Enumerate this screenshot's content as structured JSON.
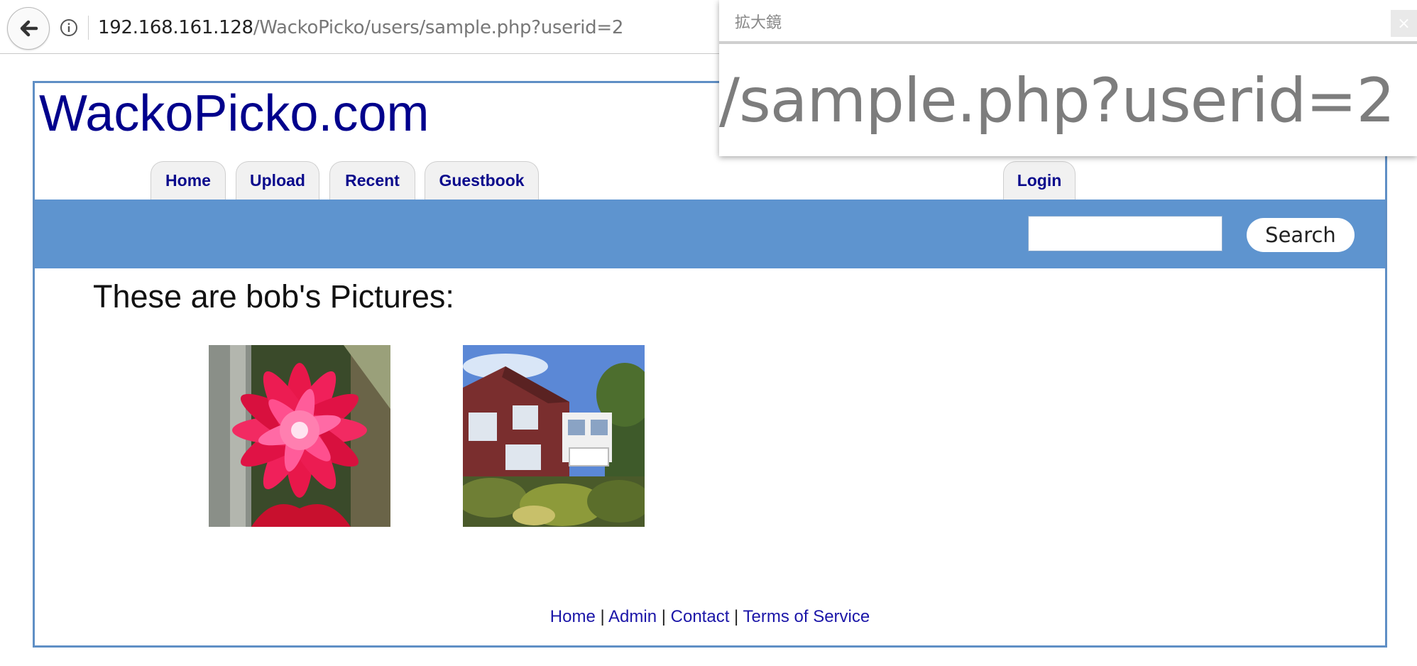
{
  "browser": {
    "url_host": "192.168.161.128",
    "url_path": "/WackoPicko/users/sample.php?userid=2",
    "back_icon": "back-arrow-icon",
    "info_icon": "info-icon"
  },
  "site": {
    "title": "WackoPicko.com",
    "nav": {
      "home": "Home",
      "upload": "Upload",
      "recent": "Recent",
      "guestbook": "Guestbook",
      "login": "Login"
    },
    "search": {
      "value": "",
      "button_label": "Search"
    },
    "heading": "These are bob's Pictures:",
    "footer": {
      "home": "Home",
      "admin": "Admin",
      "contact": "Contact",
      "terms": "Terms of Service",
      "separator": " | "
    },
    "colors": {
      "title": "#00008c",
      "bar": "#5e94cf",
      "frame": "#5f8fc5"
    }
  },
  "magnifier": {
    "title": "拡大鏡",
    "close_label": "×",
    "zoomed_text": "/sample.php?userid=2"
  }
}
